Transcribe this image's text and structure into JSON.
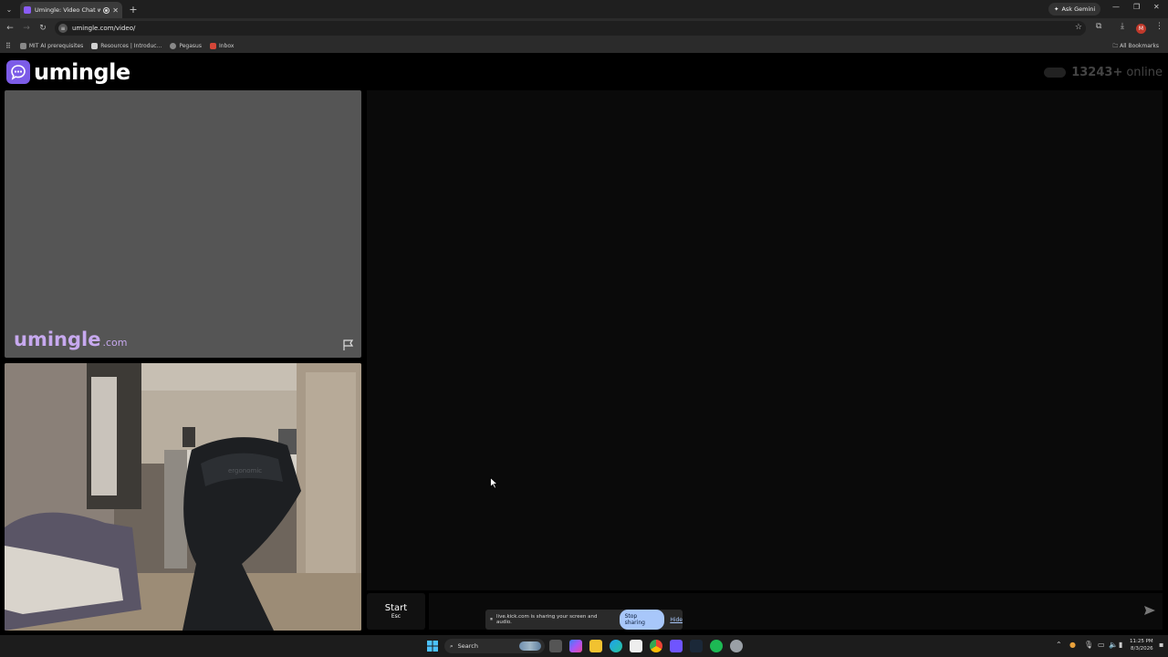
{
  "browser": {
    "tab_title": "Umingle: Video Chat with S",
    "new_tab": "+",
    "ask_gemini": "Ask Gemini",
    "url": "umingle.com/video/",
    "profile_initial": "M",
    "bookmarks": [
      "MIT AI prerequisites",
      "Resources | Introduc...",
      "Pegasus",
      "Inbox"
    ],
    "all_bookmarks": "All Bookmarks"
  },
  "site": {
    "logo_text": "umingle",
    "online_count": "13243+",
    "online_label": "online",
    "watermark": "umingle",
    "watermark_suffix": ".com"
  },
  "chat": {
    "start_label": "Start",
    "start_key": "Esc",
    "message_placeholder": ""
  },
  "share_bar": {
    "message": "live.kick.com is sharing your screen and audio.",
    "stop_label": "Stop sharing",
    "hide_label": "Hide"
  },
  "taskbar": {
    "search_label": "Search",
    "time": "11:25 PM",
    "date": "8/3/2026"
  },
  "colors": {
    "brand": "#7c5ce8",
    "watermark": "#c7a9ef",
    "stop_button": "#a8c7fa"
  }
}
